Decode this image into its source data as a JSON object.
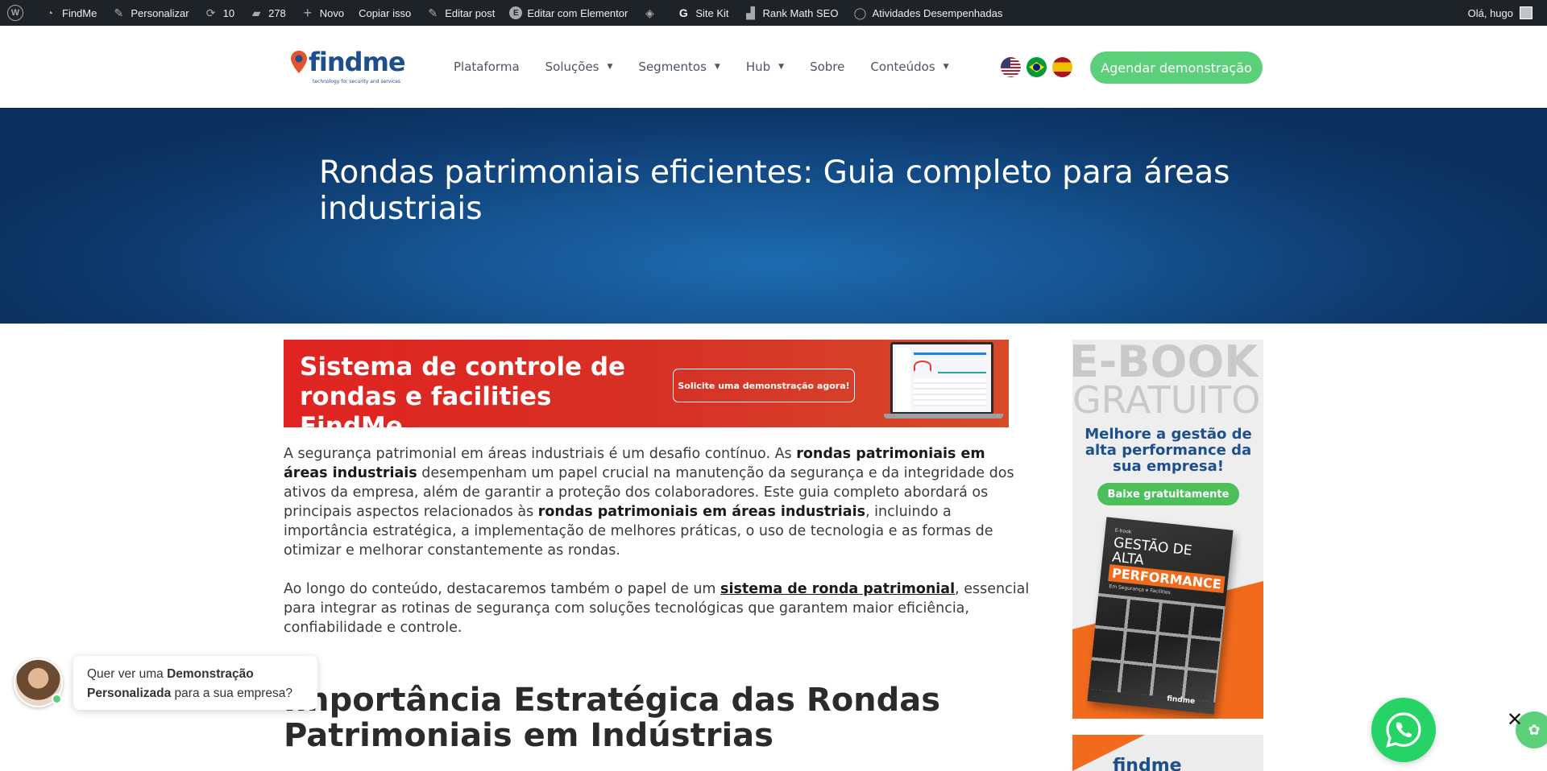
{
  "admin_bar": {
    "site_name": "FindMe",
    "customize": "Personalizar",
    "updates": "10",
    "comments": "278",
    "new": "Novo",
    "copy": "Copiar isso",
    "edit_post": "Editar post",
    "edit_elementor": "Editar com Elementor",
    "site_kit": "Site Kit",
    "rank_math": "Rank Math SEO",
    "activities": "Atividades Desempenhadas",
    "greeting": "Olá, hugo"
  },
  "header": {
    "logo_text": "findme",
    "logo_tagline": "technology for security and services",
    "nav": [
      {
        "label": "Plataforma",
        "has_dropdown": false
      },
      {
        "label": "Soluções",
        "has_dropdown": true
      },
      {
        "label": "Segmentos",
        "has_dropdown": true
      },
      {
        "label": "Hub",
        "has_dropdown": true
      },
      {
        "label": "Sobre",
        "has_dropdown": false
      },
      {
        "label": "Conteúdos",
        "has_dropdown": true
      }
    ],
    "cta": "Agendar demonstração"
  },
  "hero": {
    "title": "Rondas patrimoniais eficientes: Guia completo para áreas industriais"
  },
  "banner": {
    "title": "Sistema de controle de rondas e facilities FindMe",
    "button": "Solicite uma demonstração agora!"
  },
  "article": {
    "p1": [
      {
        "text": "A segurança patrimonial em áreas industriais é um desafio contínuo. As ",
        "bold": false
      },
      {
        "text": "rondas patrimoniais em áreas industriais",
        "bold": true
      },
      {
        "text": " desempenham um papel crucial na manutenção da segurança e da integridade dos ativos da empresa, além de garantir a proteção dos colaboradores. Este guia completo abordará os principais aspectos relacionados às ",
        "bold": false
      },
      {
        "text": "rondas patrimoniais em áreas industriais",
        "bold": true
      },
      {
        "text": ", incluindo a importância estratégica, a implementação de melhores práticas, o uso de tecnologia e as formas de otimizar e melhorar constantemente as rondas.",
        "bold": false
      }
    ],
    "p2_before": "Ao longo do conteúdo, destacaremos também o papel de um ",
    "p2_link": "sistema de ronda patrimonial",
    "p2_after": ", essencial para integrar as rotinas de segurança com soluções tecnológicas que garantem maior eficiência, confiabilidade e controle.",
    "h2": "Importância Estratégica das Rondas Patrimoniais em Indústrias"
  },
  "sidebar": {
    "ebook_big1": "E-BOOK",
    "ebook_big2": "GRATUITO",
    "ebook_headline": "Melhore a gestão de alta performance da sua empresa!",
    "ebook_button": "Baixe gratuitamente",
    "book_label": "E-book",
    "book_title_1": "GESTÃO DE ALTA",
    "book_title_2": "PERFORMANCE",
    "book_subtitle": "Em Segurança e Facilities",
    "book_logo": "findme",
    "ad2_logo": "findme"
  },
  "chat": {
    "text_before": "Quer ver uma ",
    "text_bold": "Demonstração Personalizada",
    "text_after": " para a sua empresa?"
  },
  "colors": {
    "admin_bar": "#1d2327",
    "accent_green": "#5ccf7a",
    "hero_blue": "#155390",
    "banner_red": "#e02421",
    "brand_blue": "#1e4e8c",
    "whatsapp": "#25d366"
  }
}
